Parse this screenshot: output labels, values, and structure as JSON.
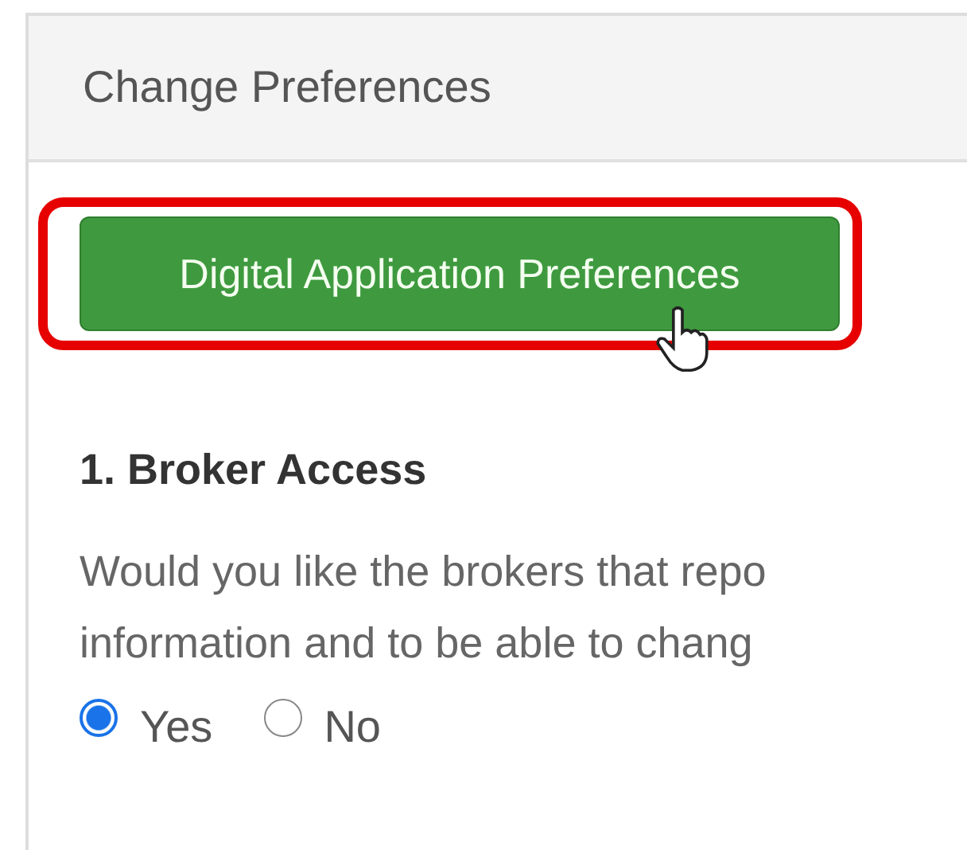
{
  "panel": {
    "title": "Change Preferences"
  },
  "button": {
    "label": "Digital Application Preferences",
    "highlighted": true
  },
  "section": {
    "heading": "1. Broker Access",
    "lines": [
      "Would you like the brokers that repo",
      "information and to be able to chang"
    ],
    "options": [
      {
        "label": "Yes",
        "selected": true
      },
      {
        "label": "No",
        "selected": false
      }
    ]
  }
}
